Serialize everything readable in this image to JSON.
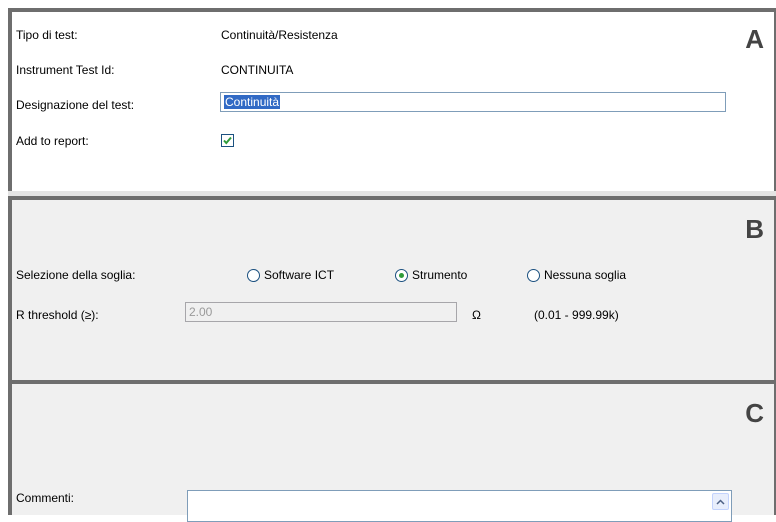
{
  "section_a": {
    "letter": "A",
    "test_type_label": "Tipo di test:",
    "test_type_value": "Continuità/Resistenza",
    "instrument_id_label": "Instrument Test Id:",
    "instrument_id_value": "CONTINUITA",
    "designation_label": "Designazione del test:",
    "designation_value": "Continuità",
    "add_report_label": "Add to report:",
    "add_report_checked": true
  },
  "section_b": {
    "letter": "B",
    "threshold_select_label": "Selezione della soglia:",
    "options": [
      {
        "label": "Software ICT",
        "checked": false
      },
      {
        "label": "Strumento",
        "checked": true
      },
      {
        "label": "Nessuna soglia",
        "checked": false
      }
    ],
    "r_threshold_label": "R threshold (≥):",
    "r_threshold_value": "2.00",
    "unit": "Ω",
    "range": "(0.01 - 999.99k)"
  },
  "section_c": {
    "letter": "C",
    "comments_label": "Commenti:",
    "comments_value": ""
  },
  "colors": {
    "border": "#6e6e6e",
    "panel_bg": "#f0f0f0",
    "selection": "#316ac5",
    "check": "#2f9b3a"
  }
}
